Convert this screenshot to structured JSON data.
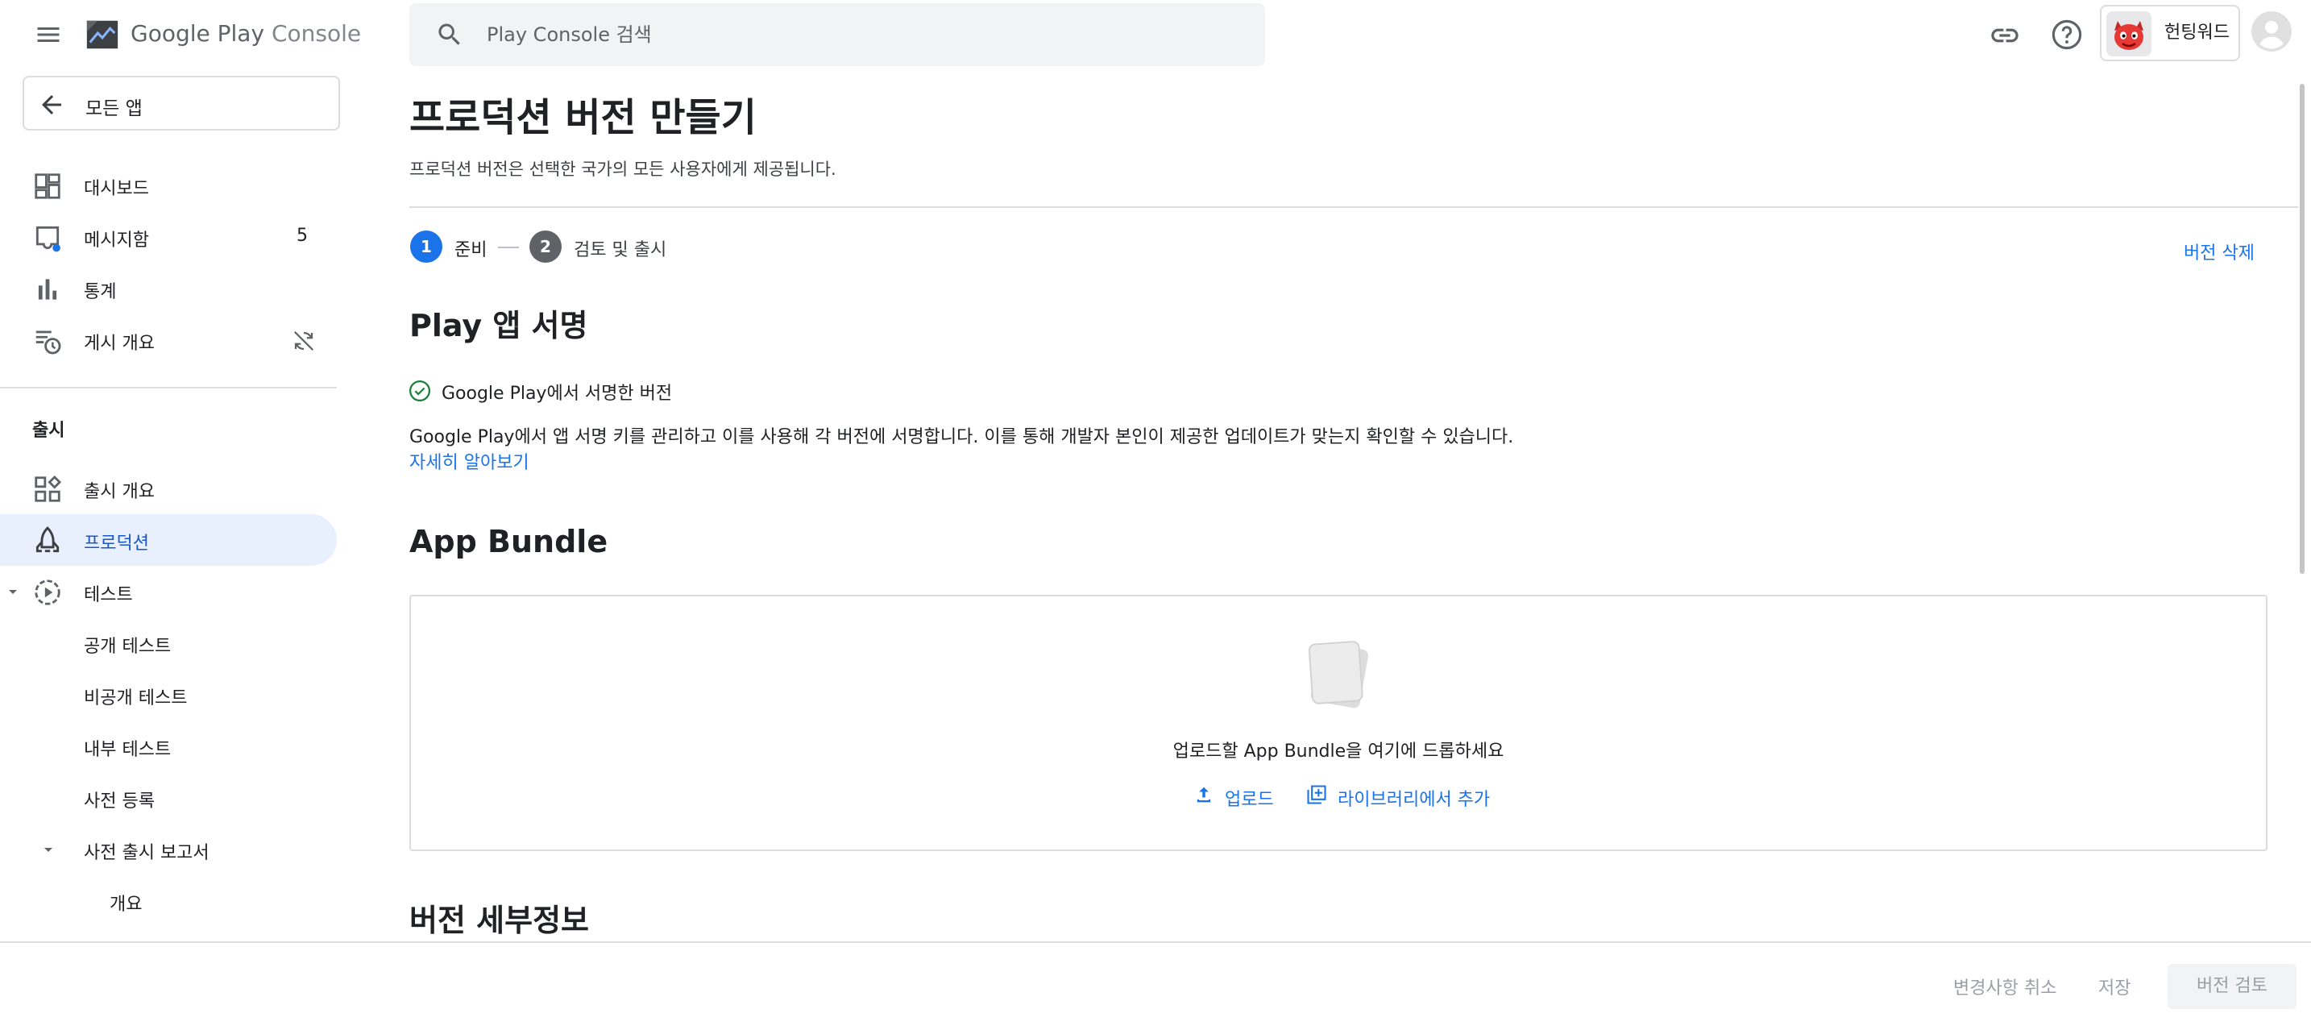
{
  "header": {
    "logo_google": "Google Play",
    "logo_console": "Console",
    "search_placeholder": "Play Console 검색",
    "account_name": "헌팅워드"
  },
  "sidebar": {
    "back_label": "모든 앱",
    "items": [
      {
        "label": "대시보드",
        "icon": "dashboard-icon"
      },
      {
        "label": "메시지함",
        "icon": "inbox-icon",
        "count": "5"
      },
      {
        "label": "통계",
        "icon": "bar-chart-icon"
      },
      {
        "label": "게시 개요",
        "icon": "publishing-overview-icon"
      }
    ],
    "section_release": "출시",
    "release_items": [
      {
        "label": "출시 개요",
        "icon": "release-overview-icon"
      },
      {
        "label": "프로덕션",
        "icon": "production-icon",
        "active": true
      },
      {
        "label": "테스트",
        "icon": "testing-icon",
        "expanded": true
      },
      {
        "label": "공개 테스트"
      },
      {
        "label": "비공개 테스트"
      },
      {
        "label": "내부 테스트"
      },
      {
        "label": "사전 등록"
      },
      {
        "label": "사전 출시 보고서",
        "expanded": true
      },
      {
        "label": "개요"
      }
    ]
  },
  "main": {
    "title": "프로덕션 버전 만들기",
    "subtitle": "프로덕션 버전은 선택한 국가의 모든 사용자에게 제공됩니다.",
    "steps": [
      {
        "number": "1",
        "label": "준비",
        "active": true
      },
      {
        "number": "2",
        "label": "검토 및 출시",
        "active": false
      }
    ],
    "delete_release": "버전 삭제",
    "signing": {
      "title": "Play 앱 서명",
      "status": "Google Play에서 서명한 버전",
      "description": "Google Play에서 앱 서명 키를 관리하고 이를 사용해 각 버전에 서명합니다. 이를 통해 개발자 본인이 제공한 업데이트가 맞는지 확인할 수 있습니다.",
      "learn_more": "자세히 알아보기"
    },
    "bundle": {
      "title": "App Bundle",
      "drop_text": "업로드할 App Bundle을 여기에 드롭하세요",
      "upload": "업로드",
      "add_from_library": "라이브러리에서 추가"
    },
    "details_title": "버전 세부정보"
  },
  "footer": {
    "discard": "변경사항 취소",
    "save": "저장",
    "review": "버전 검토"
  },
  "colors": {
    "accent": "#1a73e8",
    "active_nav_bg": "#e8f0fe",
    "success": "#188038"
  }
}
